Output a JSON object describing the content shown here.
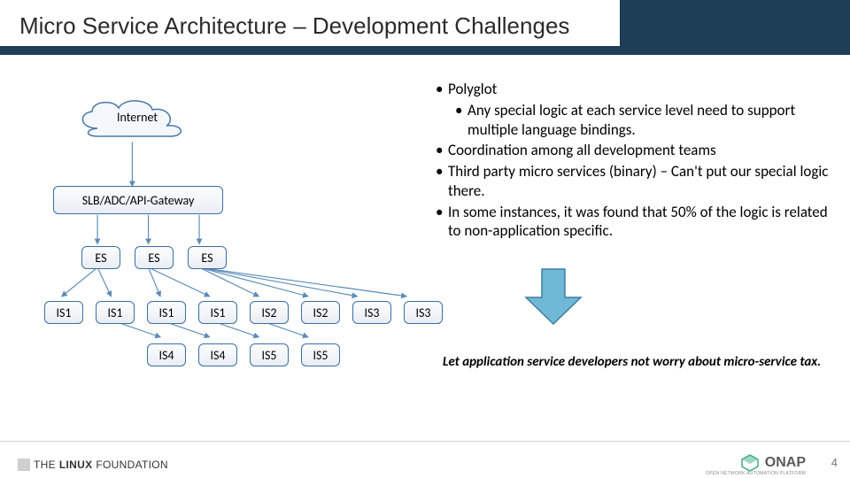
{
  "title": "Micro Service Architecture – Development Challenges",
  "diagram": {
    "cloud": "Internet",
    "gateway": "SLB/ADC/API-Gateway",
    "es": [
      "ES",
      "ES",
      "ES"
    ],
    "row1": [
      "IS1",
      "IS1",
      "IS1",
      "IS1",
      "IS2",
      "IS2",
      "IS3",
      "IS3"
    ],
    "row2": [
      "IS4",
      "IS4",
      "IS5",
      "IS5"
    ]
  },
  "bullets": {
    "b1": "Polyglot",
    "b1a": "Any special logic at each service level need to support multiple language bindings.",
    "b2": "Coordination among all development teams",
    "b3": "Third party micro services (binary) – Can't put our special logic there.",
    "b4": "In some instances, it was found that 50% of the logic is related to non-application specific."
  },
  "footnote": "Let application service developers not worry about micro-service tax.",
  "logos": {
    "left_pre": "THE",
    "left_main": "LINUX",
    "left_post": "FOUNDATION",
    "right": "ONAP",
    "right_sub": "OPEN NETWORK AUTOMATION PLATFORM"
  },
  "page": "4"
}
